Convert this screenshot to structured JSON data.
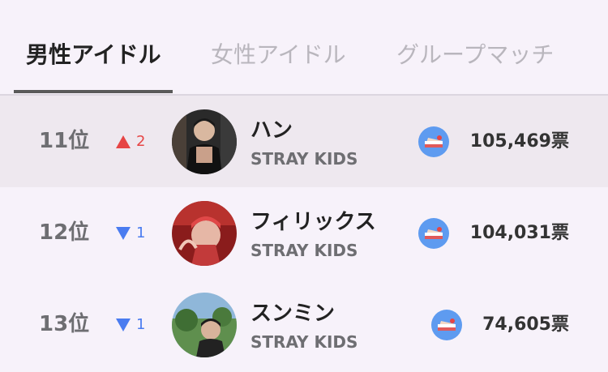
{
  "tabs": [
    {
      "label": "男性アイドル",
      "active": true
    },
    {
      "label": "女性アイドル",
      "active": false
    },
    {
      "label": "グループマッチ",
      "active": false
    }
  ],
  "colors": {
    "background": "#f7f2fa",
    "highlight_row": "#eee8ef",
    "up": "#e64545",
    "down": "#4a7cf0",
    "cake_badge": "#5e9bf0"
  },
  "ranking": [
    {
      "rank": "11位",
      "change_dir": "up",
      "change_icon": "triangle-up-icon",
      "change": "2",
      "name": "ハン",
      "group": "STRAY KIDS",
      "votes": "105,469票",
      "highlight": true
    },
    {
      "rank": "12位",
      "change_dir": "down",
      "change_icon": "triangle-down-icon",
      "change": "1",
      "name": "フィリックス",
      "group": "STRAY KIDS",
      "votes": "104,031票",
      "highlight": false
    },
    {
      "rank": "13位",
      "change_dir": "down",
      "change_icon": "triangle-down-icon",
      "change": "1",
      "name": "スンミン",
      "group": "STRAY KIDS",
      "votes": "74,605票",
      "highlight": false
    }
  ]
}
